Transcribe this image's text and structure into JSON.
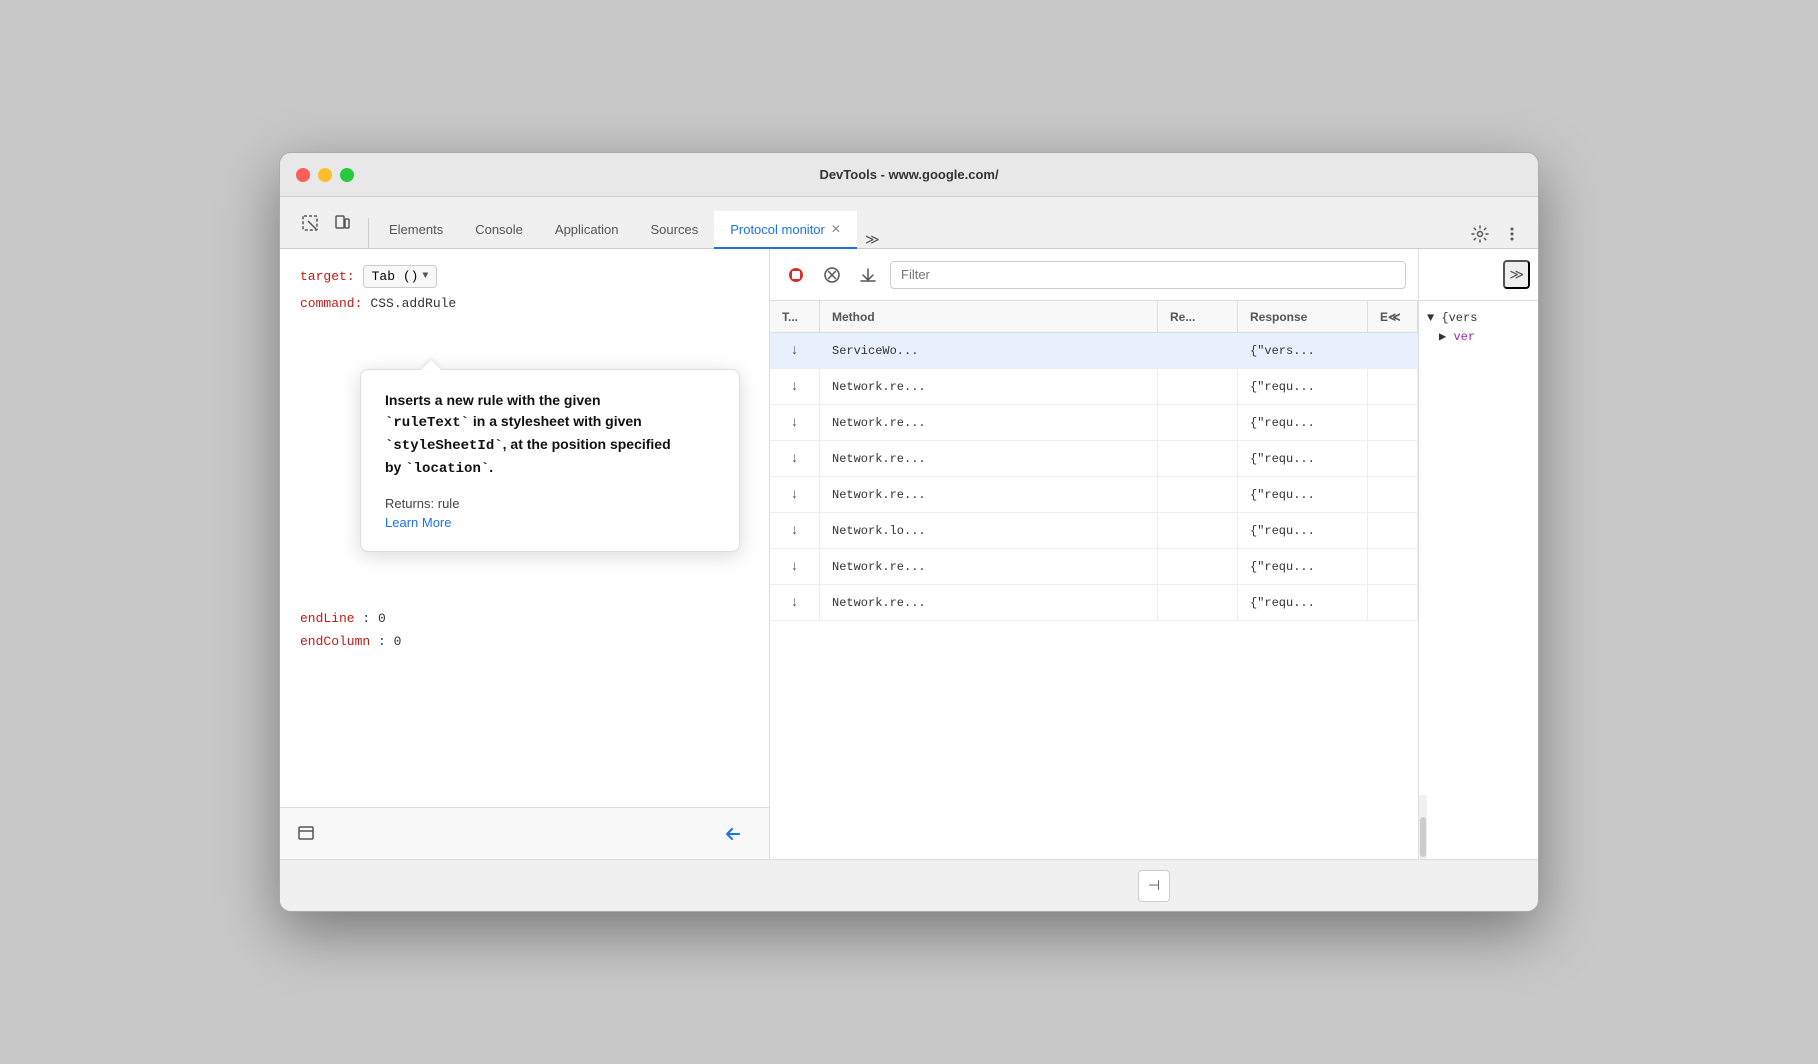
{
  "window": {
    "title": "DevTools - www.google.com/"
  },
  "tabs": {
    "items": [
      {
        "label": "Elements",
        "active": false,
        "closeable": false
      },
      {
        "label": "Console",
        "active": false,
        "closeable": false
      },
      {
        "label": "Application",
        "active": false,
        "closeable": false
      },
      {
        "label": "Sources",
        "active": false,
        "closeable": false
      },
      {
        "label": "Protocol monitor",
        "active": true,
        "closeable": true
      },
      {
        "label": "≫",
        "active": false,
        "closeable": false
      }
    ]
  },
  "left_panel": {
    "target_label": "target:",
    "target_value": "Tab ()",
    "command_label": "command:",
    "command_value": "CSS.addRule",
    "fields": [
      {
        "key": "endLine",
        "value": "0"
      },
      {
        "key": "endColumn",
        "value": "0"
      }
    ]
  },
  "tooltip": {
    "title": "Inserts a new rule with the given `ruleText` in a stylesheet with given `styleSheetId`, at the position specified by `location`.",
    "returns_label": "Returns: rule",
    "learn_more": "Learn More"
  },
  "protocol_panel": {
    "filter_placeholder": "Filter",
    "columns": [
      "T...",
      "Method",
      "Re...",
      "Response",
      "E≪"
    ],
    "rows": [
      {
        "type": "↓",
        "method": "ServiceWo...",
        "re": "",
        "response": "{\"vers...",
        "selected": true
      },
      {
        "type": "↓",
        "method": "Network.re...",
        "re": "",
        "response": "{\"requ...",
        "selected": false
      },
      {
        "type": "↓",
        "method": "Network.re...",
        "re": "",
        "response": "{\"requ...",
        "selected": false
      },
      {
        "type": "↓",
        "method": "Network.re...",
        "re": "",
        "response": "{\"requ...",
        "selected": false
      },
      {
        "type": "↓",
        "method": "Network.re...",
        "re": "",
        "response": "{\"requ...",
        "selected": false
      },
      {
        "type": "↓",
        "method": "Network.lo...",
        "re": "",
        "response": "{\"requ...",
        "selected": false
      },
      {
        "type": "↓",
        "method": "Network.re...",
        "re": "",
        "response": "{\"requ...",
        "selected": false
      },
      {
        "type": "↓",
        "method": "Network.re...",
        "re": "",
        "response": "{\"requ...",
        "selected": false
      }
    ]
  },
  "detail_panel": {
    "expand_label": "≫",
    "lines": [
      {
        "text": "▼ {vers",
        "type": "object"
      },
      {
        "text": "▶ ver",
        "type": "property",
        "purple": true
      }
    ]
  },
  "bottom_bar": {
    "send_icon": "▶",
    "panel_toggle_icon": "⊣"
  }
}
